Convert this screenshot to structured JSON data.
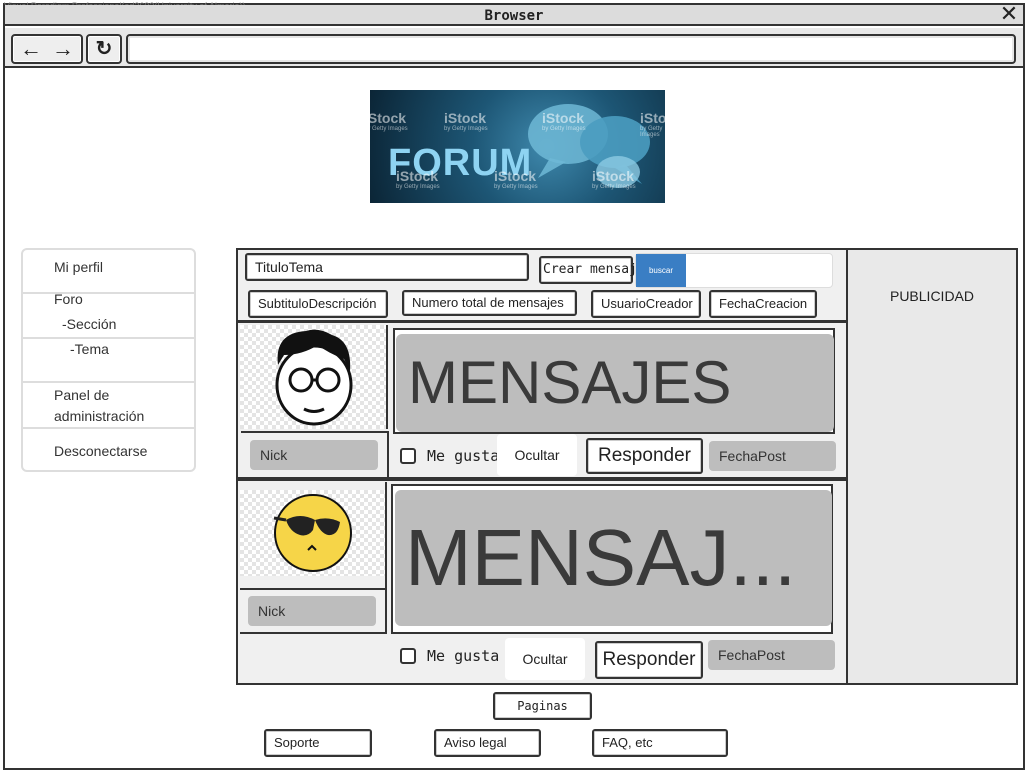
{
  "watermark": "Visual Paradigm Professional(ad3693(University of Almeria))",
  "window": {
    "title": "Browser",
    "close_glyph": "✕"
  },
  "toolbar": {
    "back_glyph": "←",
    "forward_glyph": "→",
    "reload_glyph": "↻",
    "url_value": ""
  },
  "logo": {
    "text": "FORUM",
    "watermark": "iStock",
    "watermark_sub": "by Getty Images"
  },
  "sidebar": {
    "items": [
      {
        "label": "Mi perfil"
      },
      {
        "label": "Foro"
      },
      {
        "label": "-Sección"
      },
      {
        "label": "-Tema"
      },
      {
        "label": "Panel de"
      },
      {
        "label": "administración"
      },
      {
        "label": "Desconectarse"
      }
    ]
  },
  "topic": {
    "title_value": "TituloTema",
    "create_label": "Crear mensaje",
    "search_label": "buscar",
    "search_value": "",
    "subtitle": "SubtituloDescripción",
    "total_messages": "Numero total de mensajes",
    "creator": "UsuarioCreador",
    "created_at": "FechaCreacion"
  },
  "posts": [
    {
      "nick": "Nick",
      "message": "MENSAJES",
      "like_label": "Me gusta",
      "hide_label": "Ocultar",
      "reply_label": "Responder",
      "date": "FechaPost",
      "avatar_icon": "glasses-man-avatar-icon"
    },
    {
      "nick": "Nick",
      "message": "MENSAJ...",
      "like_label": "Me gusta",
      "hide_label": "Ocultar",
      "reply_label": "Responder",
      "date": "FechaPost",
      "avatar_icon": "sunglasses-smiley-avatar-icon"
    }
  ],
  "advertising": "PUBLICIDAD",
  "pagination": {
    "label": "Paginas"
  },
  "footer": {
    "links": [
      {
        "label": "Soporte"
      },
      {
        "label": "Aviso legal"
      },
      {
        "label": "FAQ, etc"
      }
    ]
  }
}
